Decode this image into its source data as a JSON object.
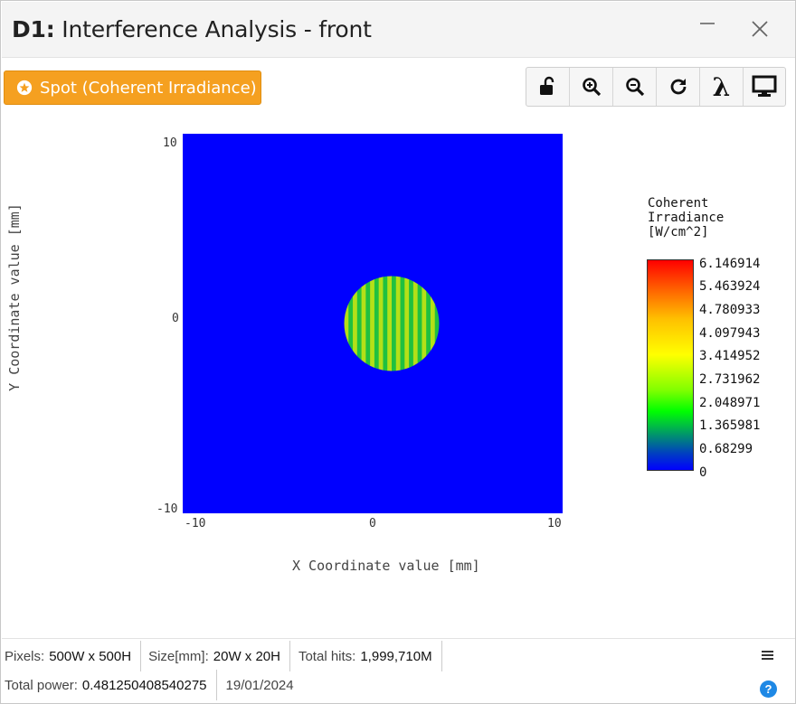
{
  "window": {
    "title_bold": "D1:",
    "title_rest": " Interference Analysis - front"
  },
  "toolbar": {
    "spot_label": "Spot (Coherent Irradiance)",
    "tools": [
      "unlock-icon",
      "zoom-in-icon",
      "zoom-out-icon",
      "refresh-icon",
      "lambda-icon",
      "display-icon"
    ],
    "lambda_glyph": "λ"
  },
  "chart_data": {
    "type": "heatmap",
    "xlabel": "X Coordinate value [mm]",
    "ylabel": "Y Coordinate value [mm]",
    "xlim": [
      -10,
      10
    ],
    "ylim": [
      -10,
      10
    ],
    "x_ticks": [
      "-10",
      "0",
      "10"
    ],
    "y_ticks": [
      "10",
      "0",
      "-10"
    ],
    "background_value": 0,
    "spot": {
      "shape": "circle",
      "center": [
        1,
        0
      ],
      "radius": 2.5,
      "fringes": "vertical",
      "fringe_count": 11,
      "fringe_colors": [
        "#b4e018",
        "#20c040"
      ]
    },
    "colorbar": {
      "title": [
        "Coherent",
        "Irradiance",
        "[W/cm^2]"
      ],
      "ticks": [
        "6.146914",
        "5.463924",
        "4.780933",
        "4.097943",
        "3.414952",
        "2.731962",
        "2.048971",
        "1.365981",
        "0.68299",
        "0"
      ],
      "range": [
        0,
        6.146914
      ]
    },
    "colors": {
      "background": "#0000ff"
    }
  },
  "status": {
    "pixels_label": "Pixels:",
    "pixels_value": "500W x 500H",
    "size_label": "Size[mm]:",
    "size_value": "20W x 20H",
    "hits_label": "Total hits:",
    "hits_value": "1,999,710M",
    "power_label": "Total power:",
    "power_value": "0.481250408540275",
    "date": "19/01/2024",
    "help_glyph": "?"
  },
  "colors": {
    "accent": "#f5a020",
    "help": "#1e88e5"
  }
}
